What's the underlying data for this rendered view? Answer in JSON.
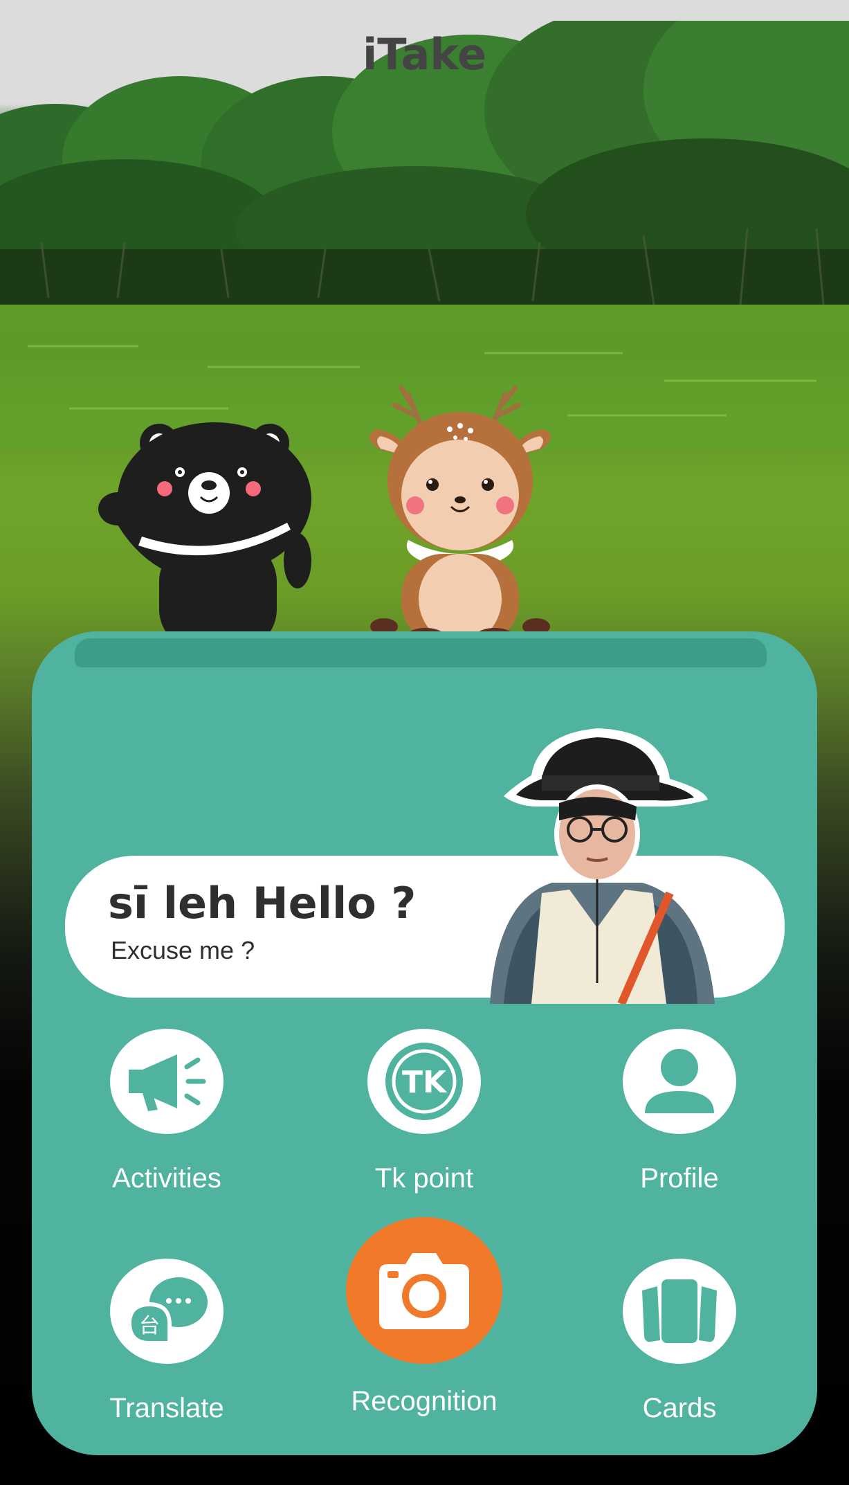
{
  "app": {
    "title": "iTake"
  },
  "greeting": {
    "phrase": "sī leh Hello ?",
    "translation": "Excuse me ?"
  },
  "menu": [
    {
      "label": "Activities",
      "icon": "megaphone-icon"
    },
    {
      "label": "Tk point",
      "icon": "tk-coin-icon",
      "icon_text": "TK"
    },
    {
      "label": "Profile",
      "icon": "user-icon"
    },
    {
      "label": "Translate",
      "icon": "translate-chat-icon",
      "icon_text": "台"
    },
    {
      "label": "Recognition",
      "icon": "camera-icon",
      "highlighted": true
    },
    {
      "label": "Cards",
      "icon": "cards-icon"
    }
  ],
  "colors": {
    "panel": "#4fb39f",
    "icon_teal": "#4fb39f",
    "accent_orange": "#f0792a",
    "title": "#444444"
  }
}
